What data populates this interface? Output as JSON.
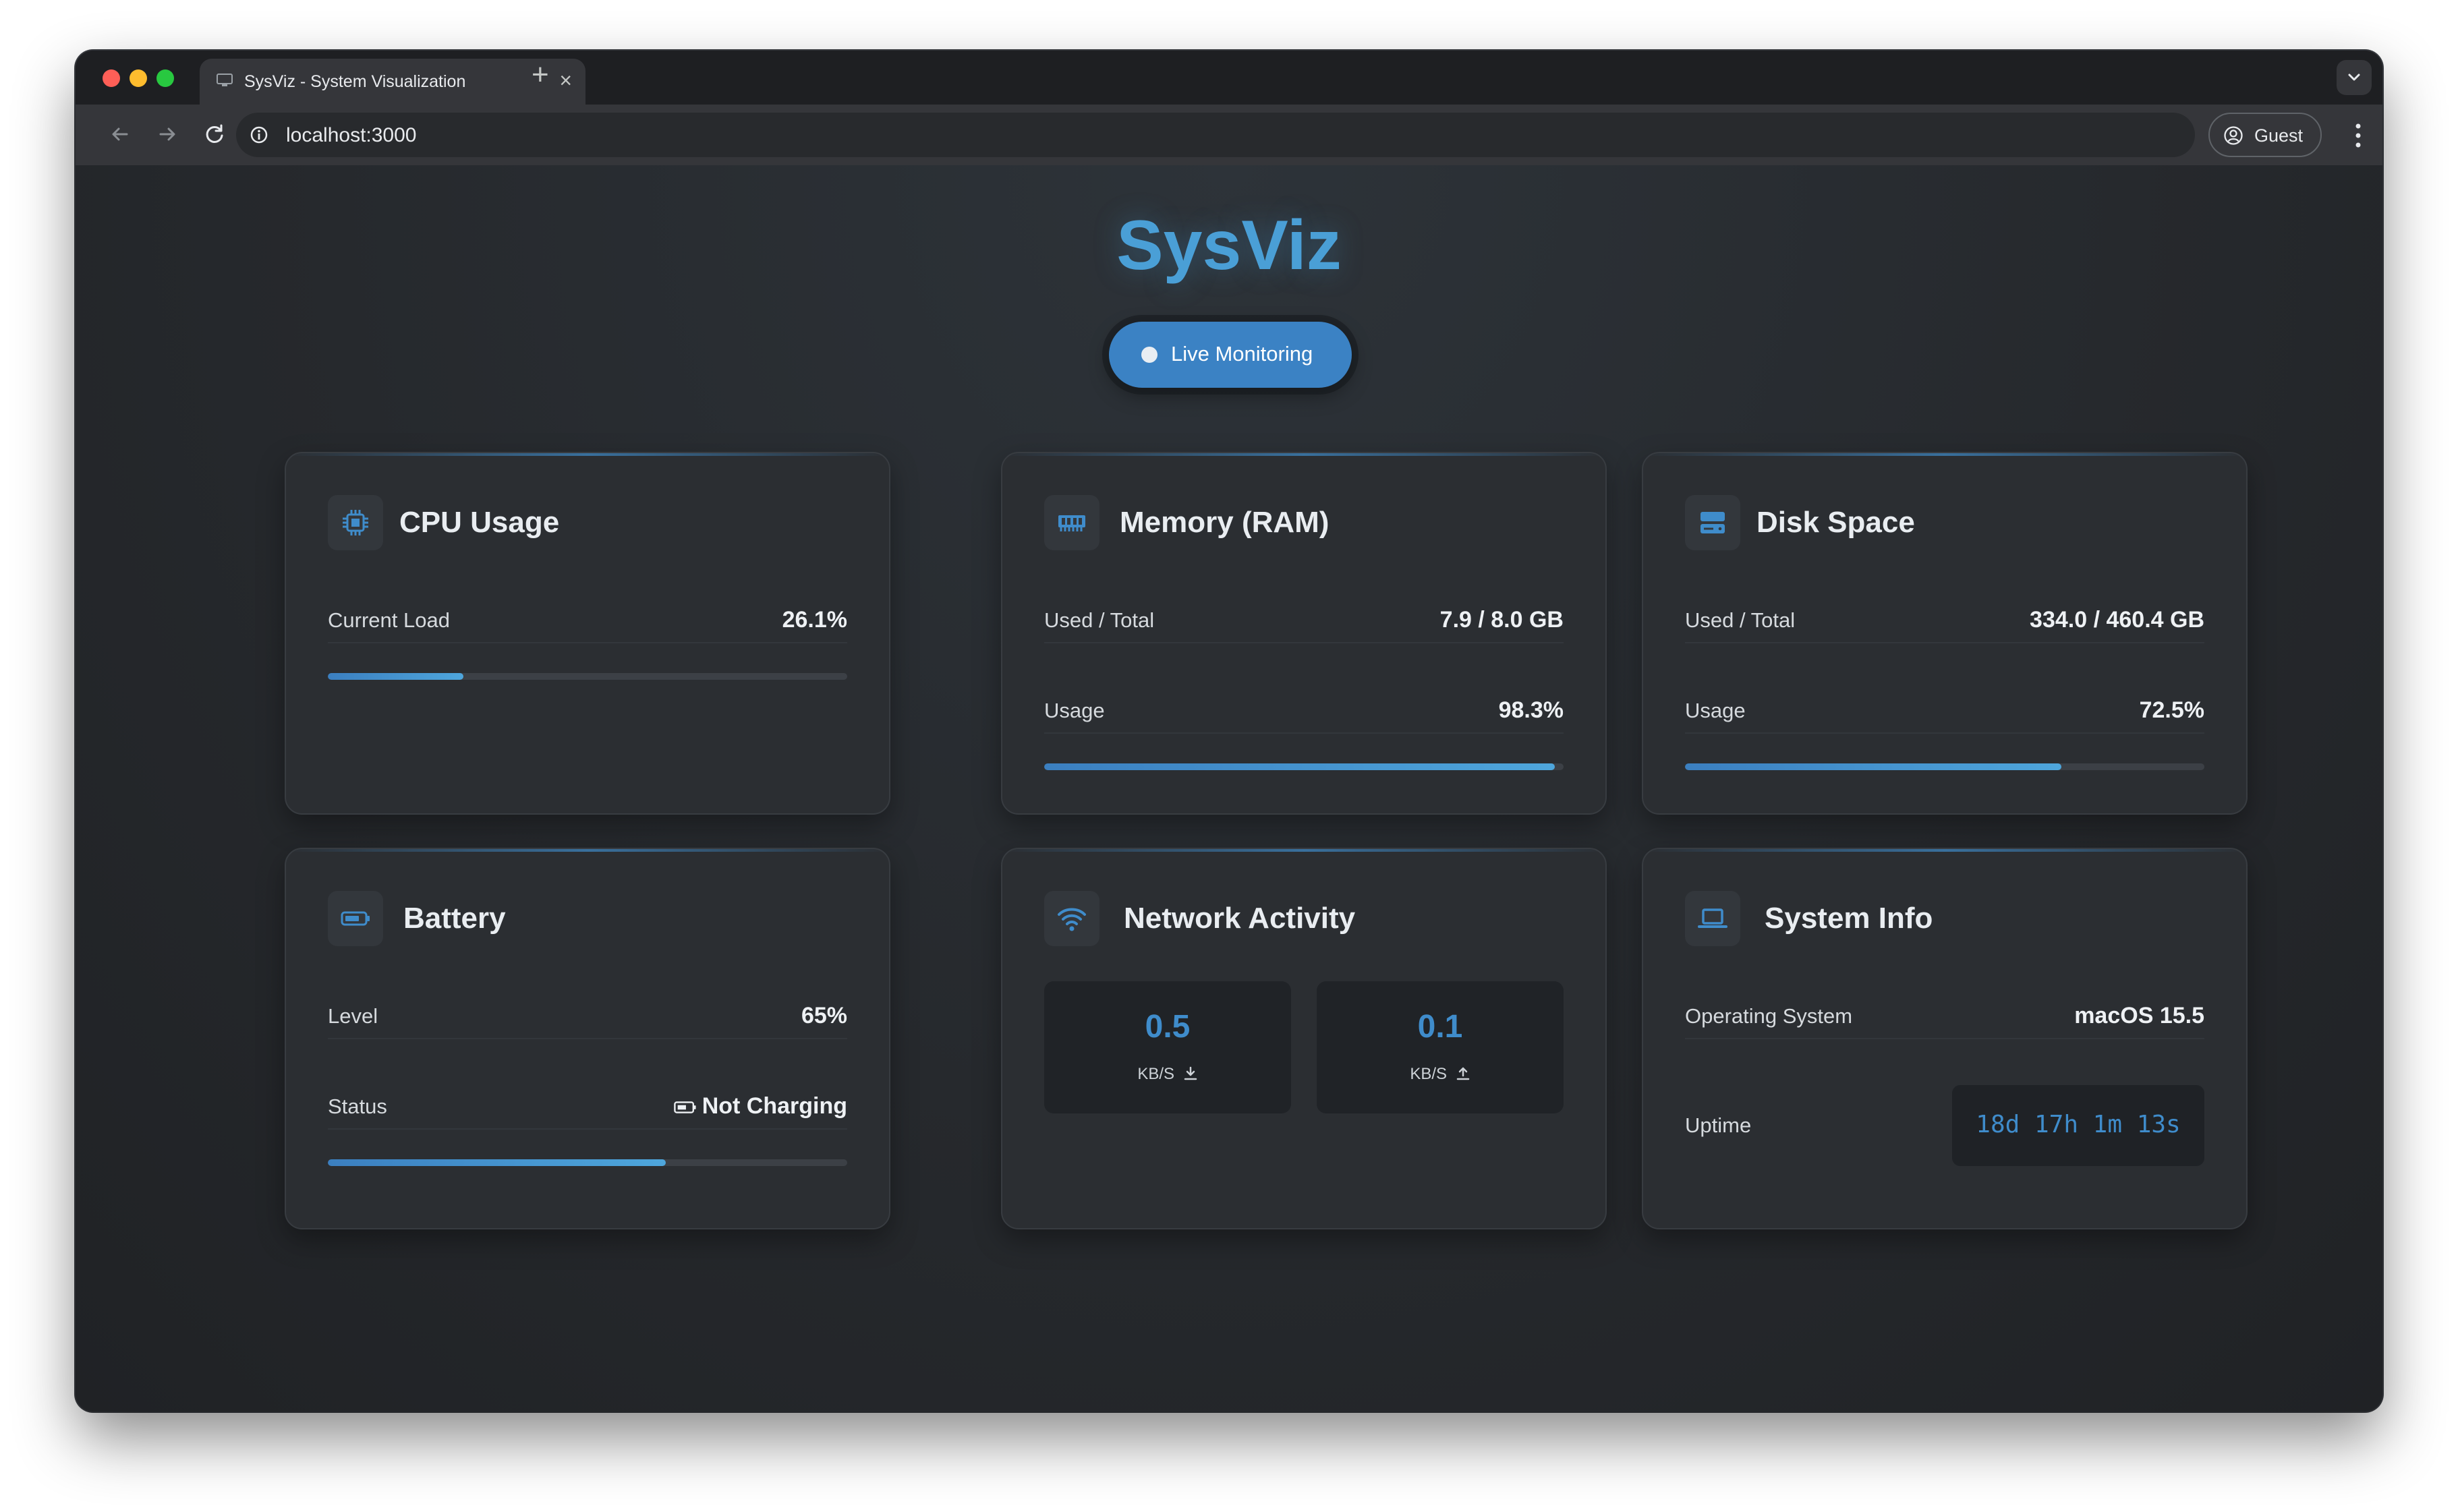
{
  "browser": {
    "tab_title": "SysViz - System Visualization",
    "url": "localhost:3000",
    "guest_label": "Guest"
  },
  "header": {
    "title": "SysViz",
    "live_label": "Live Monitoring"
  },
  "colors": {
    "accent": "#4a9fd6",
    "button": "#3b82c4",
    "card": "#2b2e32",
    "background": "#26292d"
  },
  "cards": {
    "cpu": {
      "title": "CPU Usage",
      "icon": "cpu-chip-icon",
      "load_label": "Current Load",
      "load_value": "26.1%",
      "load_percent": 26.1
    },
    "memory": {
      "title": "Memory (RAM)",
      "icon": "memory-module-icon",
      "used_label": "Used / Total",
      "used_value": "7.9 / 8.0 GB",
      "usage_label": "Usage",
      "usage_value": "98.3%",
      "usage_percent": 98.3
    },
    "disk": {
      "title": "Disk Space",
      "icon": "hard-drive-icon",
      "used_label": "Used / Total",
      "used_value": "334.0 / 460.4 GB",
      "usage_label": "Usage",
      "usage_value": "72.5%",
      "usage_percent": 72.5
    },
    "battery": {
      "title": "Battery",
      "icon": "battery-icon",
      "level_label": "Level",
      "level_value": "65%",
      "level_percent": 65,
      "status_label": "Status",
      "status_value": "Not Charging"
    },
    "network": {
      "title": "Network Activity",
      "icon": "wifi-icon",
      "download_value": "0.5",
      "download_unit": "KB/S",
      "upload_value": "0.1",
      "upload_unit": "KB/S"
    },
    "system": {
      "title": "System Info",
      "icon": "laptop-icon",
      "os_label": "Operating System",
      "os_value": "macOS 15.5",
      "uptime_label": "Uptime",
      "uptime_value": "18d 17h 1m 13s"
    }
  }
}
